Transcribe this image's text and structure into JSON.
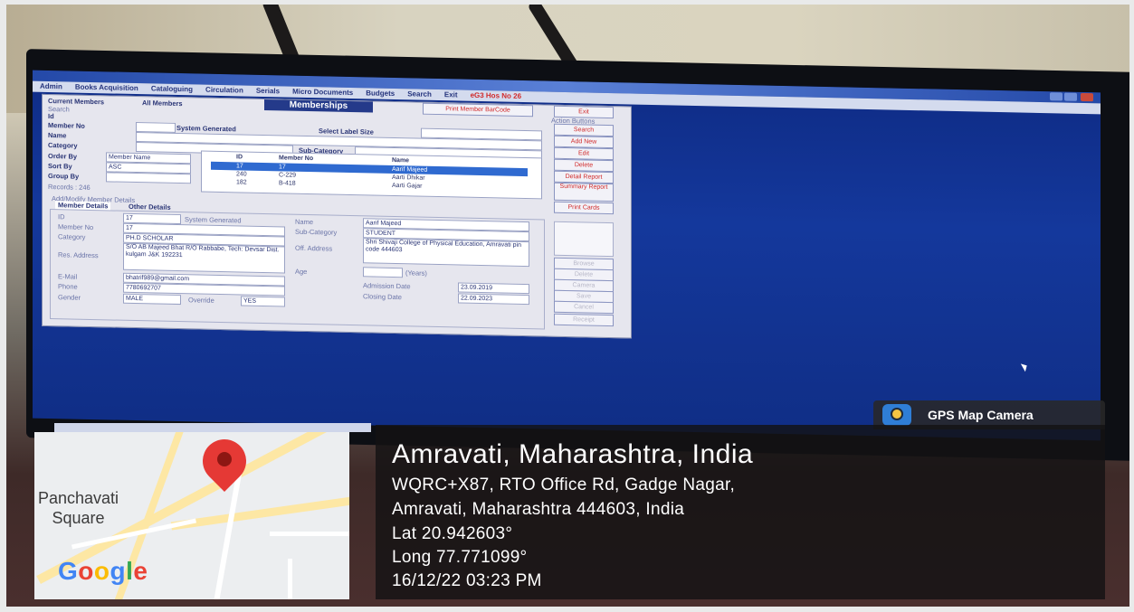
{
  "app": {
    "menu": [
      "Admin",
      "Books Acquisition",
      "Cataloguing",
      "Circulation",
      "Serials",
      "Micro Documents",
      "Budgets",
      "Search",
      "Exit"
    ],
    "menu_extra": "eG3 Hos No 26",
    "title": "Memberships",
    "radio_current": "Current Members",
    "radio_all": "All Members",
    "search_label": "Search",
    "search_id_label": "Id",
    "member_no_label": "Member No",
    "system_generated": "System Generated",
    "select_label_size": "Select Label Size",
    "print_barcode": "Print Member BarCode",
    "name_label": "Name",
    "category_label": "Category",
    "sub_category_label": "Sub-Category",
    "order_by_label": "Order By",
    "order_by_value": "Member Name",
    "sort_by_label": "Sort By",
    "sort_by_value": "ASC",
    "group_by_label": "Group By",
    "records": "Records : 246",
    "grid_headers": [
      "ID",
      "Member No",
      "Name"
    ],
    "grid_rows": [
      {
        "id": "17",
        "member_no": "17",
        "name": "Aarif Majeed",
        "selected": true
      },
      {
        "id": "240",
        "member_no": "C-229",
        "name": "Aarti Dhikar",
        "selected": false
      },
      {
        "id": "182",
        "member_no": "B-418",
        "name": "Aarti Gajar",
        "selected": false
      }
    ],
    "action_buttons_title": "Action Buttons",
    "buttons": [
      "Exit",
      "Search",
      "Add New",
      "Edit",
      "Delete",
      "Detail Report",
      "Summary Report",
      "Print Cards"
    ],
    "add_modify_label": "Add/Modify Member Details",
    "tabs": [
      "Member Details",
      "Other Details"
    ],
    "detail": {
      "id_label": "ID",
      "id_value": "17",
      "id_note": "System Generated",
      "member_no_label": "Member No",
      "member_no_value": "17",
      "category_label": "Category",
      "category_value": "PH.D SCHOLAR",
      "res_address_label": "Res. Address",
      "res_address_value": "S/O AB Majeed Bhat R/O Rabbabe, Tech: Devsar Dist. kulgam J&K 192231",
      "email_label": "E-Mail",
      "email_value": "bhatrif989@gmail.com",
      "phone_label": "Phone",
      "phone_value": "7780692707",
      "gender_label": "Gender",
      "gender_value": "MALE",
      "override_label": "Override",
      "override_value": "YES",
      "name_label": "Name",
      "name_value": "Aarif Majeed",
      "sub_category_label": "Sub-Category",
      "sub_category_value": "STUDENT",
      "off_address_label": "Off. Address",
      "off_address_value": "Shri Shivaji College of Physical Education, Amravati pin code 444603",
      "age_label": "Age",
      "age_unit": "(Years)",
      "admission_label": "Admission Date",
      "admission_value": "23.09.2019",
      "closing_label": "Closing Date",
      "closing_value": "22.09.2023"
    },
    "side_buttons": [
      "Browse",
      "Delete",
      "Camera",
      "Save",
      "Cancel",
      "Receipt"
    ]
  },
  "overlay": {
    "badge": "GPS Map Camera",
    "location": "Amravati, Maharashtra, India",
    "address_line1": "WQRC+X87, RTO Office Rd, Gadge Nagar,",
    "address_line2": "Amravati, Maharashtra 444603, India",
    "lat": "Lat 20.942603°",
    "long": "Long 77.771099°",
    "datetime": "16/12/22 03:23 PM",
    "map_label_1": "Panchavati",
    "map_label_2": "Square",
    "map_brand": "Google",
    "brand_colors": [
      "#4285F4",
      "#EA4335",
      "#FBBC05",
      "#4285F4",
      "#34A853",
      "#EA4335"
    ]
  }
}
